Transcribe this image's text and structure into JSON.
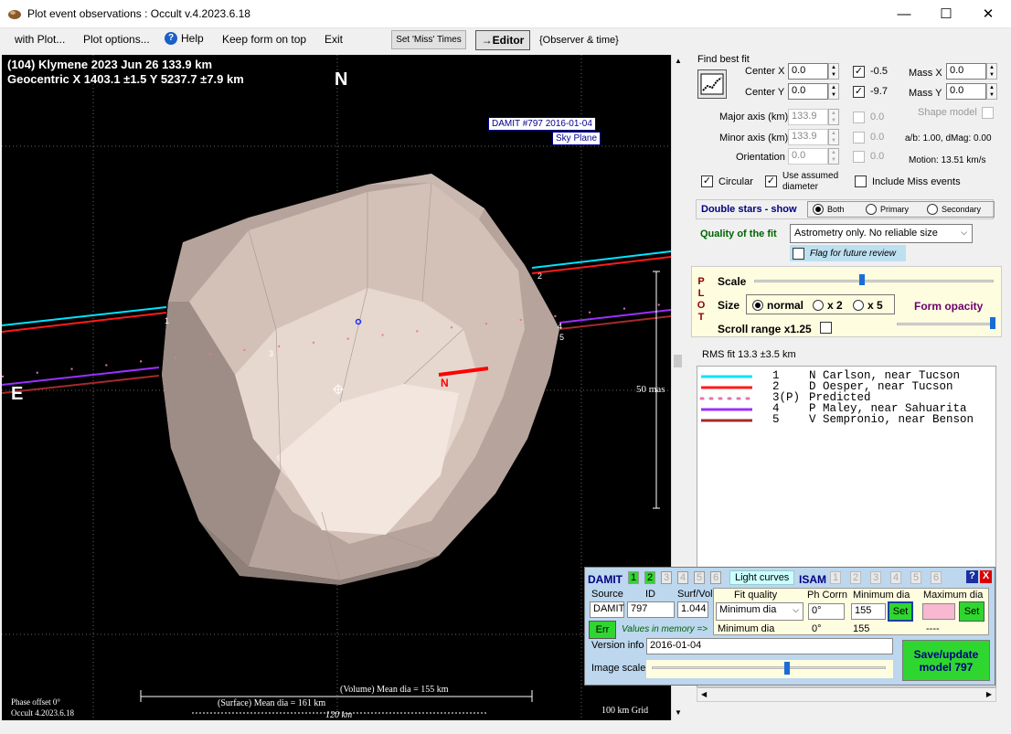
{
  "window": {
    "title": "Plot event observations : Occult v.4.2023.6.18",
    "min": "—",
    "max": "☐",
    "close": "✕"
  },
  "menu": {
    "with_plot": "with Plot...",
    "plot_options": "Plot options...",
    "help": "Help",
    "keep_form": "Keep form on top",
    "exit": "Exit",
    "set_miss": "Set 'Miss' Times",
    "editor": "→Editor",
    "observer_time": "{Observer & time}"
  },
  "plot": {
    "line1": "(104) Klymene  2023 Jun 26   133.9 km",
    "line2": "Geocentric  X  1403.1 ±1.5  Y 5237.7 ±7.9 km",
    "north": "N",
    "east": "E",
    "damit_label": "DAMIT #797 2016-01-04",
    "sky_plane": "Sky Plane",
    "scale_mas": "50 mas",
    "volume_dia": "(Volume) Mean dia = 155 km",
    "surface_dia": "(Surface) Mean dia = 161 km",
    "km120": "120 km",
    "phase": "Phase offset 0°",
    "version": "Occult 4.2023.6.18",
    "grid": "100 km Grid",
    "n_marker": "N",
    "chord_labels": [
      "1",
      "2",
      "3",
      "4",
      "5"
    ]
  },
  "fit": {
    "title": "Find best fit",
    "center_x": "Center X",
    "center_y": "Center Y",
    "cx_val": "0.0",
    "cy_val": "0.0",
    "cx_step": "-0.5",
    "cy_step": "-9.7",
    "mass_x": "Mass X",
    "mass_y": "Mass Y",
    "mx_val": "0.0",
    "my_val": "0.0",
    "major": "Major axis (km)",
    "minor": "Minor axis (km)",
    "orient": "Orientation",
    "major_val": "133.9",
    "minor_val": "133.9",
    "orient_val": "0.0",
    "major_step": "0.0",
    "minor_step": "0.0",
    "orient_step": "0.0",
    "shape_model": "Shape model",
    "ab": "a/b: 1.00, dMag: 0.00",
    "motion": "Motion: 13.51 km/s",
    "circular": "Circular",
    "use_assumed": "Use assumed",
    "diameter": "diameter",
    "include_miss": "Include Miss events",
    "double_stars": "Double stars - show",
    "both": "Both",
    "primary": "Primary",
    "secondary": "Secondary",
    "quality_label": "Quality of the fit",
    "quality_val": "Astrometry only. No reliable size",
    "flag": "Flag for future review"
  },
  "plotpanel": {
    "letters": [
      "P",
      "L",
      "O",
      "T"
    ],
    "scale": "Scale",
    "size": "Size",
    "normal": "normal",
    "x2": "x 2",
    "x5": "x 5",
    "form_opacity": "Form opacity",
    "scroll_range": "Scroll range x1.25",
    "rms": "RMS fit 13.3 ±3.5 km",
    "scale_level": 0.45,
    "opacity_level": 1.0
  },
  "legend": [
    {
      "num": "1",
      "text": "N Carlson, near Tucson",
      "color": "#00e5ff",
      "style": "solid"
    },
    {
      "num": "2",
      "text": "D Oesper, near Tucson",
      "color": "#ff1a1a",
      "style": "solid"
    },
    {
      "num": "3(P)",
      "text": "Predicted",
      "color": "#e377a8",
      "style": "dotted"
    },
    {
      "num": "4",
      "text": "P Maley, near Sahuarita",
      "color": "#9b30ff",
      "style": "solid"
    },
    {
      "num": "5",
      "text": "V Sempronio, near Benson",
      "color": "#a52a2a",
      "style": "solid"
    }
  ],
  "damit": {
    "title": "DAMIT",
    "models": [
      "1",
      "2",
      "3",
      "4",
      "5",
      "6"
    ],
    "light_curves": "Light curves",
    "isam": "ISAM",
    "isam_models": [
      "1",
      "2",
      "3",
      "4",
      "5",
      "6"
    ],
    "help": "?",
    "close": "X",
    "source": "Source",
    "id": "ID",
    "surf_vol": "Surf/Vol",
    "fit_quality": "Fit quality",
    "ph_corr": "Ph Corrn",
    "min_dia": "Minimum dia",
    "max_dia": "Maximum dia",
    "source_val": "DAMIT",
    "id_val": "797",
    "sv_val": "1.044",
    "fitq_val": "Minimum dia",
    "ph_val": "0°",
    "min_val": "155",
    "set": "Set",
    "err": "Err",
    "mem": "Values in memory =>",
    "mem_fitq": "Minimum dia",
    "mem_ph": "0°",
    "mem_min": "155",
    "mem_max": "----",
    "version_info": "Version info",
    "version_val": "2016-01-04",
    "image_scale": "Image scale",
    "save": "Save/update",
    "model": "model 797",
    "image_scale_level": 0.58
  }
}
